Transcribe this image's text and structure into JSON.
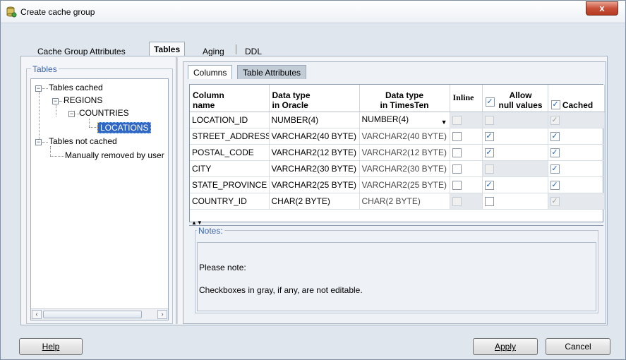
{
  "window": {
    "title": "Create cache group",
    "close_label": "x"
  },
  "top_tabs": [
    {
      "label": "Cache Group Attributes",
      "active": false
    },
    {
      "label": "Tables",
      "active": true
    },
    {
      "label": "Aging",
      "active": false
    },
    {
      "label": "DDL",
      "active": false
    }
  ],
  "tables_panel": {
    "legend": "Tables",
    "tree": {
      "cached_label": "Tables cached",
      "regions_label": "REGIONS",
      "countries_label": "COUNTRIES",
      "locations_label": "LOCATIONS",
      "not_cached_label": "Tables not cached",
      "manually_removed_label": "Manually removed by user"
    }
  },
  "sub_tabs": [
    {
      "label": "Columns",
      "active": true
    },
    {
      "label": "Table Attributes",
      "active": false
    }
  ],
  "columns_table": {
    "headers": {
      "column_name": [
        "Column",
        "name"
      ],
      "oracle_type": [
        "Data type",
        "in Oracle"
      ],
      "timesten_type": [
        "Data type",
        "in TimesTen"
      ],
      "inline": "Inline",
      "allow_null": [
        "Allow",
        "null values"
      ],
      "cached": "Cached"
    },
    "rows": [
      {
        "name": "LOCATION_ID",
        "oracle": "NUMBER(4)",
        "timesten": "NUMBER(4)",
        "inline": false,
        "allow_null": false,
        "cached": true
      },
      {
        "name": "STREET_ADDRESS",
        "oracle": "VARCHAR2(40 BYTE)",
        "timesten": "VARCHAR2(40 BYTE)",
        "inline": false,
        "allow_null": true,
        "cached": true
      },
      {
        "name": "POSTAL_CODE",
        "oracle": "VARCHAR2(12 BYTE)",
        "timesten": "VARCHAR2(12 BYTE)",
        "inline": false,
        "allow_null": true,
        "cached": true
      },
      {
        "name": "CITY",
        "oracle": "VARCHAR2(30 BYTE)",
        "timesten": "VARCHAR2(30 BYTE)",
        "inline": false,
        "allow_null": false,
        "cached": true
      },
      {
        "name": "STATE_PROVINCE",
        "oracle": "VARCHAR2(25 BYTE)",
        "timesten": "VARCHAR2(25 BYTE)",
        "inline": false,
        "allow_null": true,
        "cached": true
      },
      {
        "name": "COUNTRY_ID",
        "oracle": "CHAR(2 BYTE)",
        "timesten": "CHAR(2 BYTE)",
        "inline": false,
        "allow_null": false,
        "cached": true
      }
    ]
  },
  "notes": {
    "legend": "Notes:",
    "line1": "Please note:",
    "line2": "Checkboxes in gray, if any, are not editable."
  },
  "buttons": {
    "help": "Help",
    "apply": "Apply",
    "cancel": "Cancel"
  }
}
